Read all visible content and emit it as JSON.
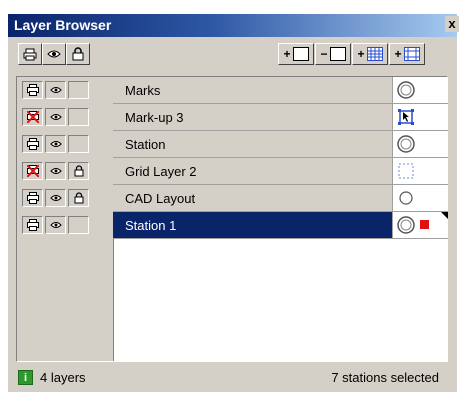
{
  "window": {
    "title": "Layer Browser",
    "close_label": "x"
  },
  "header_toggles": [
    {
      "icon": "printer-icon"
    },
    {
      "icon": "eye-icon"
    },
    {
      "icon": "lock-icon"
    }
  ],
  "action_buttons": [
    {
      "sign": "+",
      "icon": "layer-icon"
    },
    {
      "sign": "−",
      "icon": "layer-icon"
    },
    {
      "sign": "+",
      "icon": "grid-layer-icon"
    },
    {
      "sign": "+",
      "icon": "grid-frame-icon"
    }
  ],
  "layers": [
    {
      "name": "Marks",
      "print": true,
      "visible": true,
      "locked": false,
      "symbol": "double-circle"
    },
    {
      "name": "Mark-up 3",
      "print": false,
      "visible": true,
      "locked": false,
      "symbol": "cursor-frame"
    },
    {
      "name": "Station",
      "print": true,
      "visible": true,
      "locked": false,
      "symbol": "double-circle"
    },
    {
      "name": "Grid Layer 2",
      "print": false,
      "visible": true,
      "locked": true,
      "symbol": "dotted-square"
    },
    {
      "name": "CAD Layout",
      "print": true,
      "visible": true,
      "locked": true,
      "symbol": "circle"
    },
    {
      "name": "Station 1",
      "print": true,
      "visible": true,
      "locked": false,
      "symbol": "double-circle",
      "selected": true
    }
  ],
  "status": {
    "layers": "4 layers",
    "stations": "7 stations selected"
  },
  "colors": {
    "selected_row": "#0a246a",
    "panel": "#d4d0c8",
    "accent_red": "#e01010"
  }
}
